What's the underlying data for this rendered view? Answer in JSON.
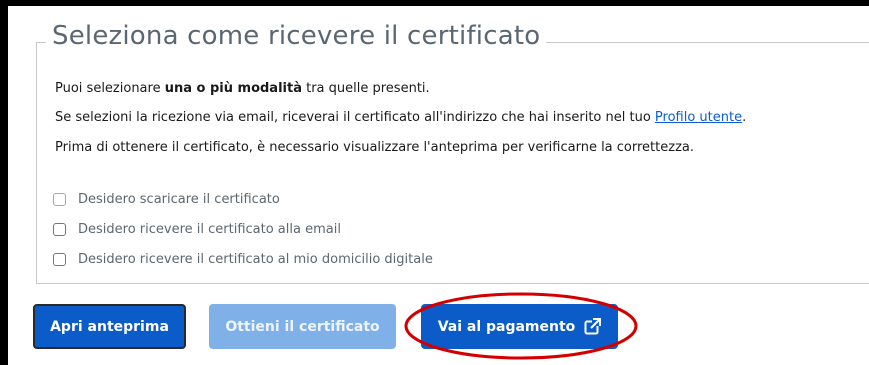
{
  "section": {
    "title": "Seleziona come ricevere il certificato"
  },
  "info": {
    "line1_prefix": "Puoi selezionare ",
    "line1_bold": "una o più modalità",
    "line1_suffix": " tra quelle presenti.",
    "line2_prefix": "Se selezioni la ricezione via email, riceverai il certificato all'indirizzo che hai inserito nel tuo ",
    "line2_link": "Profilo utente",
    "line2_suffix": ".",
    "line3": "Prima di ottenere il certificato, è necessario visualizzare l'anteprima per verificarne la correttezza."
  },
  "options": [
    {
      "label": "Desidero scaricare il certificato",
      "checked": false
    },
    {
      "label": "Desidero ricevere il certificato alla email",
      "checked": false
    },
    {
      "label": "Desidero ricevere il certificato al mio domicilio digitale",
      "checked": false
    }
  ],
  "buttons": {
    "preview": "Apri anteprima",
    "get_certificate": "Ottieni il certificato",
    "payment": "Vai al pagamento"
  },
  "icons": {
    "payment_icon": "external-link-icon"
  },
  "colors": {
    "primary": "#0b5cc9",
    "disabled": "#7fb0e8",
    "link": "#0b5cd6",
    "annotation": "#d40000"
  }
}
